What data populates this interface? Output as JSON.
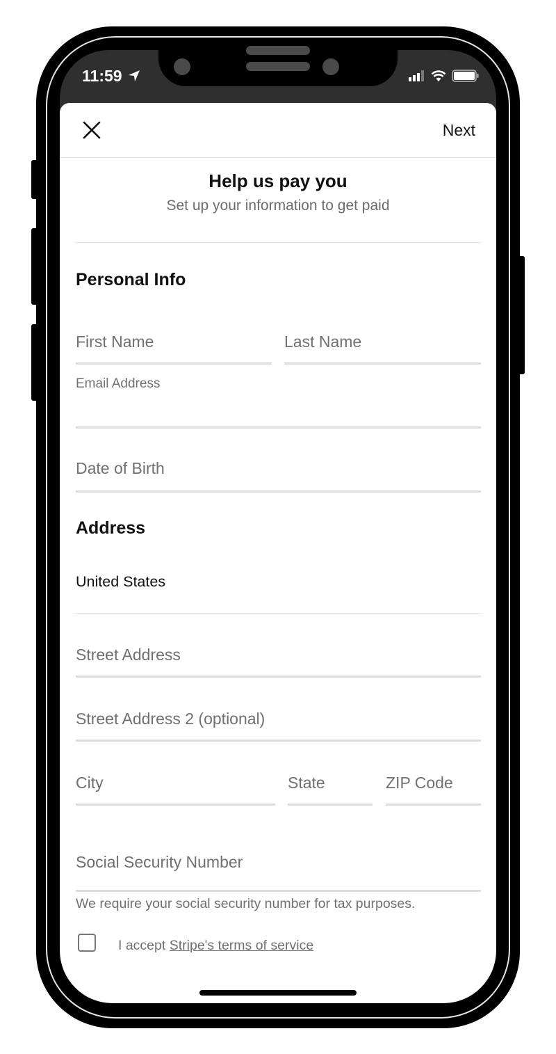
{
  "status_bar": {
    "time": "11:59",
    "icons": [
      "location-arrow-icon",
      "cellular-signal-icon",
      "wifi-icon",
      "battery-icon"
    ]
  },
  "nav": {
    "close_icon": "close-icon",
    "next_label": "Next"
  },
  "header": {
    "title": "Help us pay you",
    "subtitle": "Set up your information to get paid"
  },
  "personal_info": {
    "heading": "Personal Info",
    "first_name_placeholder": "First Name",
    "last_name_placeholder": "Last Name",
    "email_label": "Email Address",
    "email_value": "",
    "dob_placeholder": "Date of Birth"
  },
  "address": {
    "heading": "Address",
    "country": "United States",
    "street_placeholder": "Street Address",
    "street2_placeholder": "Street Address 2 (optional)",
    "city_placeholder": "City",
    "state_placeholder": "State",
    "zip_placeholder": "ZIP Code"
  },
  "ssn": {
    "placeholder": "Social Security Number",
    "note": "We require your social security number for tax purposes."
  },
  "terms": {
    "checked": false,
    "prefix": "I accept ",
    "link_text": "Stripe's terms of service"
  }
}
